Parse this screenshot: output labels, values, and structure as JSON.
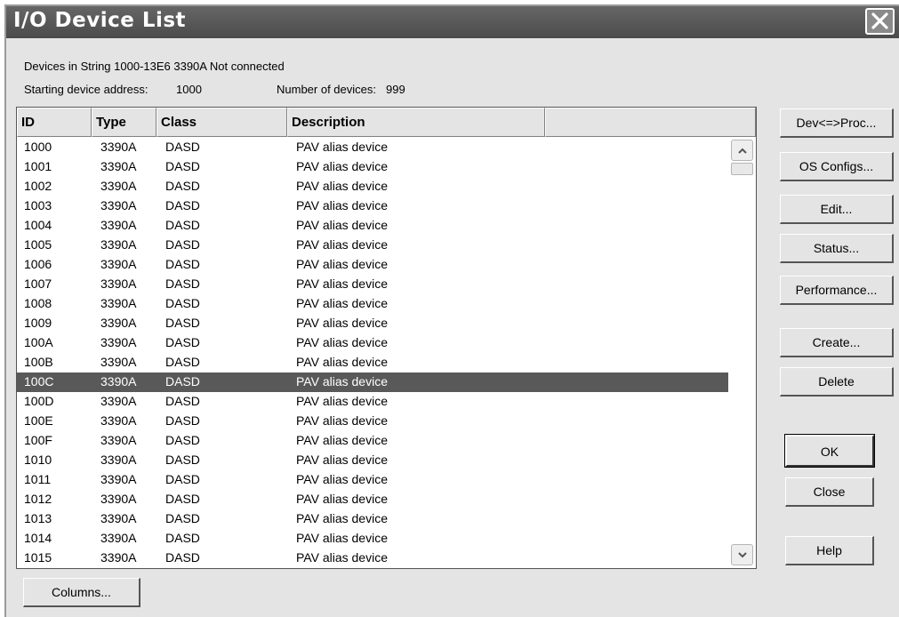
{
  "window": {
    "title": "I/O Device List"
  },
  "info": {
    "string_line": "Devices in String 1000-13E6 3390A Not connected",
    "start_label": "Starting device address:",
    "start_value": "1000",
    "count_label": "Number of devices:",
    "count_value": "999"
  },
  "table": {
    "columns": [
      "ID",
      "Type",
      "Class",
      "Description",
      ""
    ],
    "selected_index": 12,
    "rows": [
      [
        "1000",
        "3390A",
        "DASD",
        "PAV alias device"
      ],
      [
        "1001",
        "3390A",
        "DASD",
        "PAV alias device"
      ],
      [
        "1002",
        "3390A",
        "DASD",
        "PAV alias device"
      ],
      [
        "1003",
        "3390A",
        "DASD",
        "PAV alias device"
      ],
      [
        "1004",
        "3390A",
        "DASD",
        "PAV alias device"
      ],
      [
        "1005",
        "3390A",
        "DASD",
        "PAV alias device"
      ],
      [
        "1006",
        "3390A",
        "DASD",
        "PAV alias device"
      ],
      [
        "1007",
        "3390A",
        "DASD",
        "PAV alias device"
      ],
      [
        "1008",
        "3390A",
        "DASD",
        "PAV alias device"
      ],
      [
        "1009",
        "3390A",
        "DASD",
        "PAV alias device"
      ],
      [
        "100A",
        "3390A",
        "DASD",
        "PAV alias device"
      ],
      [
        "100B",
        "3390A",
        "DASD",
        "PAV alias device"
      ],
      [
        "100C",
        "3390A",
        "DASD",
        "PAV alias device"
      ],
      [
        "100D",
        "3390A",
        "DASD",
        "PAV alias device"
      ],
      [
        "100E",
        "3390A",
        "DASD",
        "PAV alias device"
      ],
      [
        "100F",
        "3390A",
        "DASD",
        "PAV alias device"
      ],
      [
        "1010",
        "3390A",
        "DASD",
        "PAV alias device"
      ],
      [
        "1011",
        "3390A",
        "DASD",
        "PAV alias device"
      ],
      [
        "1012",
        "3390A",
        "DASD",
        "PAV alias device"
      ],
      [
        "1013",
        "3390A",
        "DASD",
        "PAV alias device"
      ],
      [
        "1014",
        "3390A",
        "DASD",
        "PAV alias device"
      ],
      [
        "1015",
        "3390A",
        "DASD",
        "PAV alias device"
      ]
    ]
  },
  "buttons": {
    "dev_proc": "Dev<=>Proc...",
    "os_configs": "OS Configs...",
    "edit": "Edit...",
    "status": "Status...",
    "performance": "Performance...",
    "create": "Create...",
    "delete": "Delete",
    "ok": "OK",
    "close": "Close",
    "help": "Help",
    "columns": "Columns..."
  },
  "icons": {
    "close": "close-x-icon",
    "scroll_up": "chevron-up-icon",
    "scroll_down": "chevron-down-icon"
  },
  "colors": {
    "titlebar": "#595959",
    "dialog_bg": "#e4e4e4",
    "selected_row": "#595959"
  }
}
